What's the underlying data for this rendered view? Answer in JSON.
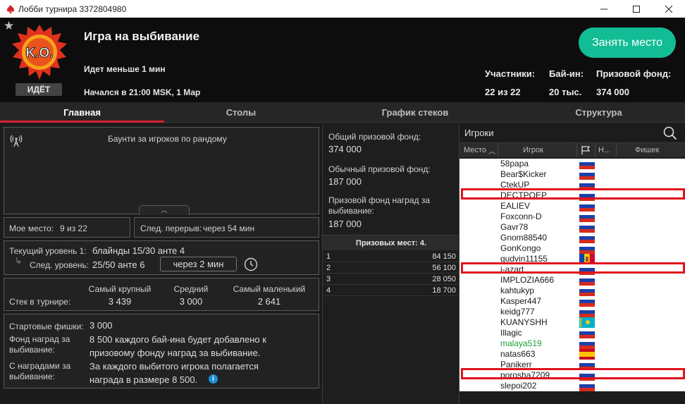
{
  "window": {
    "title": "Лобби турнира 3372804980",
    "controls": [
      "minimize-icon",
      "maximize-icon",
      "close-icon"
    ]
  },
  "header": {
    "logo_text": "K.O.",
    "status": "ИДЁТ",
    "name": "Игра на выбивание",
    "running_time": "Идет меньше 1 мин",
    "started": "Начался в 21:00 MSK, 1 Мар",
    "register_button": "Занять место",
    "stats": {
      "players_label": "Участники:",
      "players_value": "22 из 22",
      "buyin_label": "Бай-ин:",
      "buyin_value": "20 тыс.",
      "prize_label": "Призовой фонд:",
      "prize_value": "374 000"
    }
  },
  "tabs": [
    "Главная",
    "Столы",
    "График стеков",
    "Структура"
  ],
  "news": {
    "text": "Баунти за игроков по рандому"
  },
  "my_place": {
    "label": "Мое место:",
    "value": "9 из 22"
  },
  "next_break": {
    "label": "След. перерыв:",
    "value": "через 54 мин"
  },
  "levels": {
    "current_label": "Текущий уровень 1:",
    "current_value": "блайнды 15/30 анте 4",
    "next_label": "След. уровень:",
    "next_value": "25/50 анте 6",
    "next_time": "через 2 мин"
  },
  "stacks": {
    "row_label": "Стек в турнире:",
    "largest_label": "Самый крупный",
    "largest_value": "3 439",
    "average_label": "Средний",
    "average_value": "3 000",
    "smallest_label": "Самый маленький",
    "smallest_value": "2 641"
  },
  "info": {
    "start_chips_label": "Стартовые фишки:",
    "start_chips_value": "3 000",
    "bounty_fund_label": "Фонд наград за выбивание:",
    "bounty_fund_value": "8 500 каждого бай-ина будет добавлено к призовому фонду наград за выбивание.",
    "bounties_label": "С наградами за выбивание:",
    "bounties_value": "За каждого выбитого игрока полагается награда в размере 8 500."
  },
  "prize_pool": {
    "total_label": "Общий призовой фонд:",
    "total_value": "374 000",
    "regular_label": "Обычный призовой фонд:",
    "regular_value": "187 000",
    "bounty_label": "Призовой фонд наград за выбивание:",
    "bounty_value": "187 000",
    "places_label": "Призовых мест: 4.",
    "places": [
      {
        "place": "1",
        "amount": "84 150"
      },
      {
        "place": "2",
        "amount": "56 100"
      },
      {
        "place": "3",
        "amount": "28 050"
      },
      {
        "place": "4",
        "amount": "18 700"
      }
    ]
  },
  "players_panel": {
    "title": "Игроки",
    "columns": [
      "Место",
      "Игрок",
      "Н...",
      "Фишек"
    ],
    "rows": [
      {
        "name": "58papa",
        "flag": "ru",
        "highlight": false,
        "color": "#1a1a1a"
      },
      {
        "name": "Bear$Kicker",
        "flag": "ru",
        "highlight": false,
        "color": "#1a1a1a"
      },
      {
        "name": "CtekUP",
        "flag": "ru",
        "highlight": false,
        "color": "#1a1a1a"
      },
      {
        "name": "DECTPOEP",
        "flag": "ru",
        "highlight": true,
        "color": "#1a1a1a"
      },
      {
        "name": "EALIEV",
        "flag": "ru",
        "highlight": false,
        "color": "#1a1a1a"
      },
      {
        "name": "Foxconn-D",
        "flag": "ru",
        "highlight": false,
        "color": "#1a1a1a"
      },
      {
        "name": "Gavr78",
        "flag": "ru",
        "highlight": false,
        "color": "#1a1a1a"
      },
      {
        "name": "Gnom88540",
        "flag": "ru",
        "highlight": false,
        "color": "#1a1a1a"
      },
      {
        "name": "GonKongo",
        "flag": "ru",
        "highlight": false,
        "color": "#1a1a1a"
      },
      {
        "name": "gudvin11155",
        "flag": "md",
        "highlight": false,
        "color": "#1a1a1a"
      },
      {
        "name": "i-azart",
        "flag": "ru",
        "highlight": true,
        "color": "#1a1a1a"
      },
      {
        "name": "IMPLOZIA666",
        "flag": "ru",
        "highlight": false,
        "color": "#1a1a1a"
      },
      {
        "name": "kahtukyp",
        "flag": "ru",
        "highlight": false,
        "color": "#1a1a1a"
      },
      {
        "name": "Kasper447",
        "flag": "ru",
        "highlight": false,
        "color": "#1a1a1a"
      },
      {
        "name": "keidg777",
        "flag": "ru",
        "highlight": false,
        "color": "#1a1a1a"
      },
      {
        "name": "KUANYSHH",
        "flag": "kz",
        "highlight": false,
        "color": "#1a1a1a"
      },
      {
        "name": "Illagic",
        "flag": "ru",
        "highlight": false,
        "color": "#1a1a1a"
      },
      {
        "name": "malaya519",
        "flag": "ru",
        "highlight": false,
        "color": "#1e9e3a"
      },
      {
        "name": "natas663",
        "flag": "es",
        "highlight": false,
        "color": "#1a1a1a"
      },
      {
        "name": "Panikerr",
        "flag": "ru",
        "highlight": false,
        "color": "#1a1a1a"
      },
      {
        "name": "porosha7209",
        "flag": "ru",
        "highlight": true,
        "color": "#1a1a1a"
      },
      {
        "name": "slepoi202",
        "flag": "ru",
        "highlight": false,
        "color": "#1a1a1a"
      }
    ]
  },
  "colors": {
    "accent_red": "#d9222f",
    "register_green": "#12bd96",
    "highlight_red": "#e0141d"
  }
}
